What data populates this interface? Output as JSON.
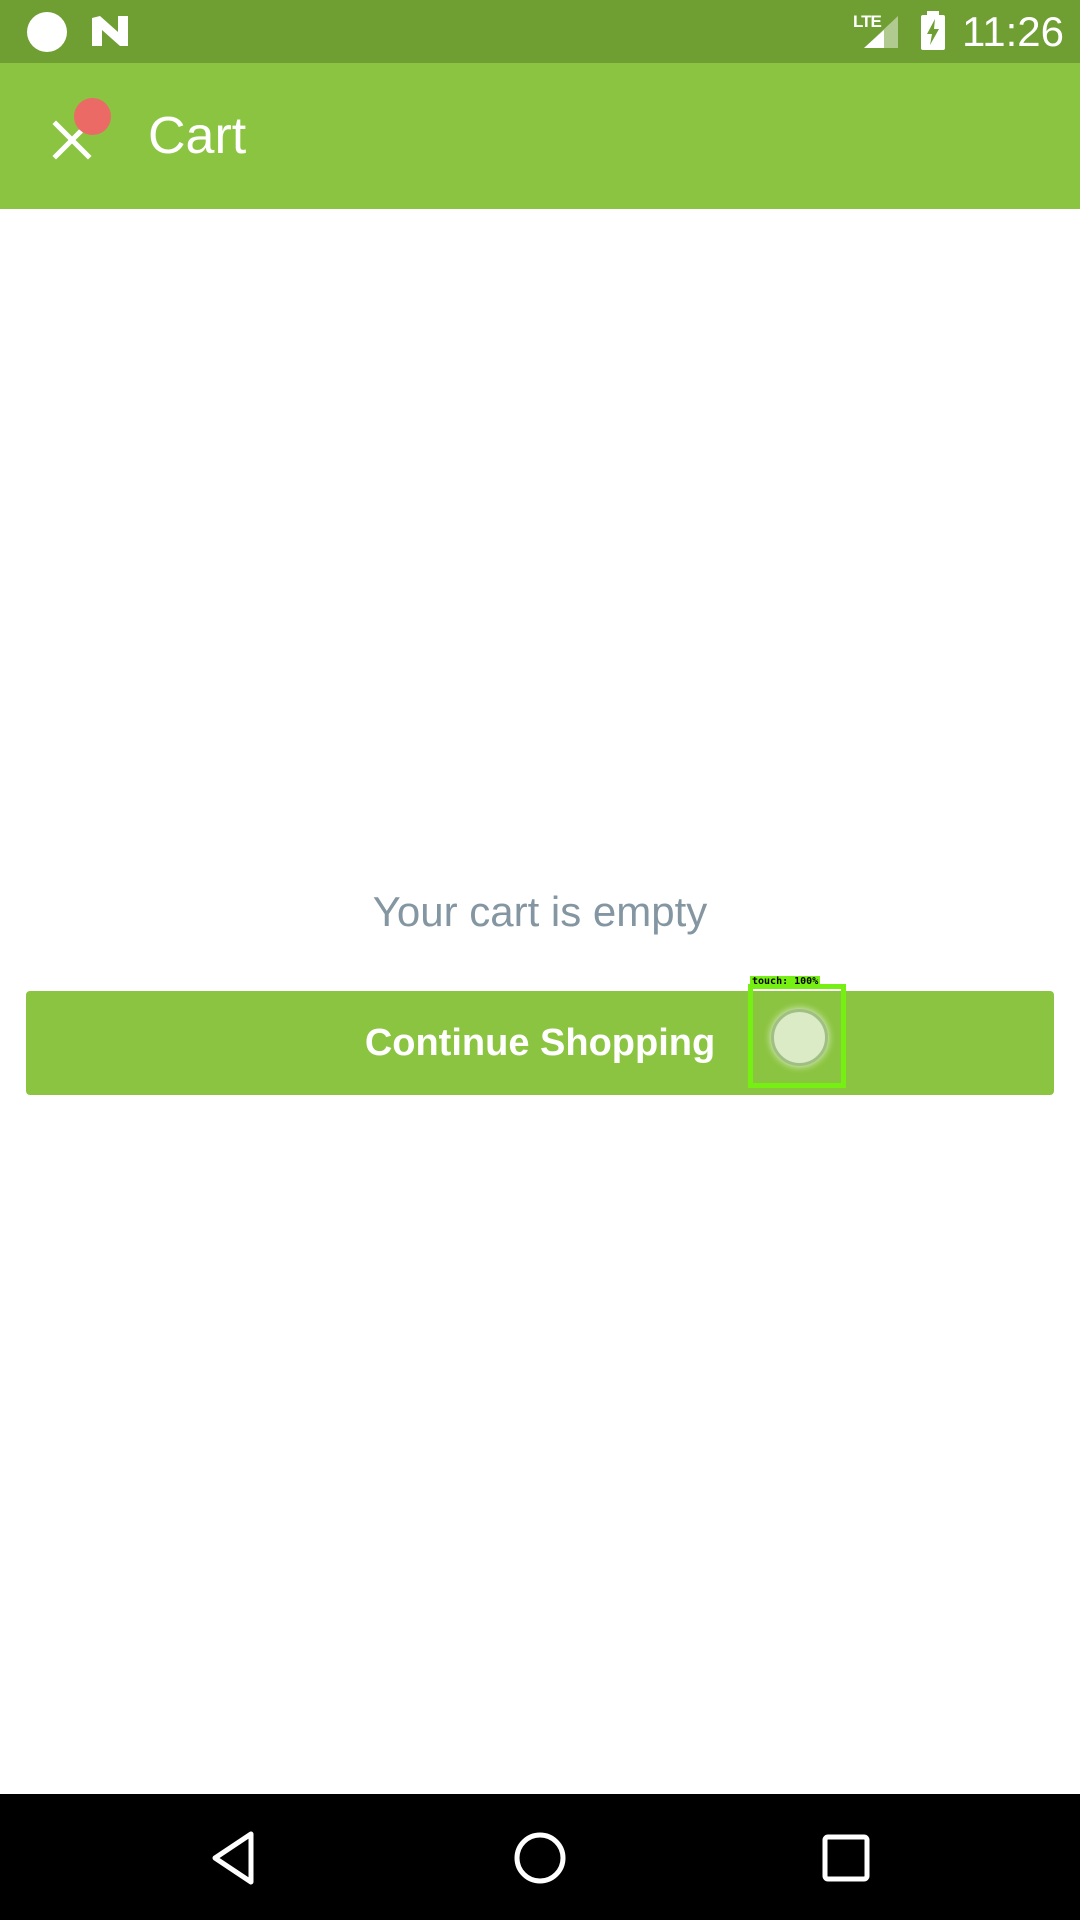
{
  "status_bar": {
    "time": "11:26",
    "network": "LTE",
    "icons": [
      "circle-icon",
      "n-icon",
      "signal-icon",
      "battery-charging-icon"
    ]
  },
  "app_bar": {
    "title": "Cart",
    "close_icon": "close-icon",
    "badge_color": "#ec6a66"
  },
  "main": {
    "empty_message": "Your cart is empty",
    "continue_button_label": "Continue Shopping"
  },
  "touch_overlay": {
    "label": "touch: 100%"
  },
  "nav_bar": {
    "icons": [
      "back-icon",
      "home-icon",
      "recents-icon"
    ]
  },
  "colors": {
    "status_bar": "#6f9e33",
    "accent": "#8bc440",
    "empty_text": "#8496a1",
    "touch_highlight": "#76ef13"
  }
}
